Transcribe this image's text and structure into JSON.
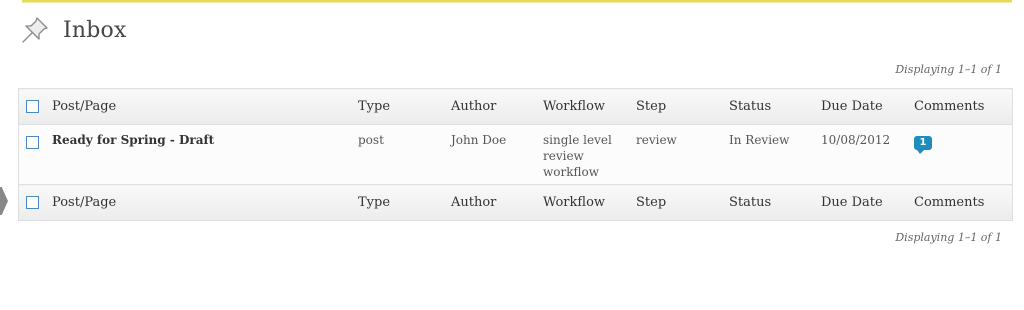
{
  "page": {
    "title": "Inbox"
  },
  "pagination": {
    "top": "Displaying 1–1 of 1",
    "bottom": "Displaying 1–1 of 1"
  },
  "table": {
    "columns": [
      "Post/Page",
      "Type",
      "Author",
      "Workflow",
      "Step",
      "Status",
      "Due Date",
      "Comments"
    ],
    "rows": [
      {
        "title": "Ready for Spring - Draft",
        "type": "post",
        "author": "John Doe",
        "workflow": "single level review workflow",
        "step": "review",
        "status": "In Review",
        "due_date": "10/08/2012",
        "comments": "1"
      }
    ]
  },
  "icons": {
    "page_icon": "pushpin-icon",
    "comment_icon": "comment-bubble-icon"
  },
  "colors": {
    "accent": "#1e8cbe",
    "checkbox_border": "#4b88c9",
    "notice_border": "#e6db55"
  }
}
